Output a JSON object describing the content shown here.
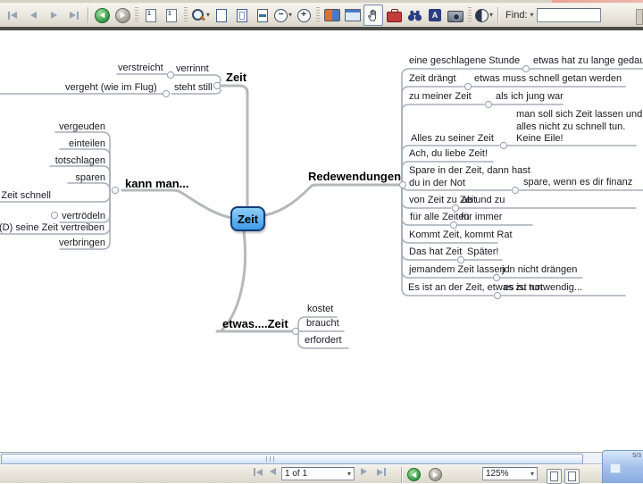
{
  "toolbar": {
    "find_label": "Find:",
    "find_value": "",
    "icons": [
      "first-page",
      "previous-page",
      "next-page",
      "last-page",
      "previous-view",
      "next-view",
      "single-page-layout",
      "continuous-layout",
      "zoom-tool",
      "actual-size",
      "fit-page",
      "fit-width",
      "zoom-out",
      "zoom-in",
      "ebook",
      "window",
      "hand-tool",
      "comment-toolbox",
      "search-binoculars",
      "select-text",
      "picture-tasks",
      "display-contrast",
      "find"
    ]
  },
  "statusbar": {
    "page_indicator": "1 of 1",
    "zoom_indicator": "125%",
    "corner_badge": "5/3"
  },
  "mindmap": {
    "root": "Zeit",
    "top": {
      "label": "Zeit",
      "n1": "verrinnt",
      "n1_child": "verstreicht",
      "n2": "steht still",
      "n2_child": "vergeht (wie im Flug)"
    },
    "left": {
      "label": "kann man...",
      "items": [
        "vergeuden",
        "einteilen",
        "totschlagen",
        "sparen",
        "Zeit schnell",
        "vertrödeln",
        "(D) seine Zeit vertreiben",
        "verbringen"
      ]
    },
    "right": {
      "label": "Redewendungen",
      "rows": [
        {
          "idiom": "eine geschlagene Stunde",
          "meaning": "etwas hat zu lange gedauert"
        },
        {
          "idiom": "Zeit drängt",
          "meaning": "etwas muss schnell getan werden"
        },
        {
          "idiom": "zu meiner Zeit",
          "meaning": "als ich jung war"
        },
        {
          "idiom": "Alles zu seiner Zeit",
          "meaning": "man soll sich Zeit lassen und\nalles nicht zu schnell tun.\nKeine Eile!"
        },
        {
          "idiom": "Ach, du liebe Zeit!",
          "meaning": ""
        },
        {
          "idiom": "Spare in der Zeit, dann hast\ndu in der Not",
          "meaning": "spare, wenn es dir finanz"
        },
        {
          "idiom": "von Zeit zu Zeit",
          "meaning": "ab und zu"
        },
        {
          "idiom": "für alle Zeiten",
          "meaning": "für immer"
        },
        {
          "idiom": "Kommt Zeit, kommt Rat",
          "meaning": ""
        },
        {
          "idiom": "Das hat Zeit",
          "meaning": "Später!"
        },
        {
          "idiom": "jemandem Zeit lassen",
          "meaning": "jdn nicht drängen"
        },
        {
          "idiom": "Es ist an der Zeit, etwas zu tun",
          "meaning": "es ist notwendig..."
        }
      ]
    },
    "bottom": {
      "label": "etwas....Zeit",
      "items": [
        "kostet",
        "braucht",
        "erfordert"
      ]
    }
  }
}
